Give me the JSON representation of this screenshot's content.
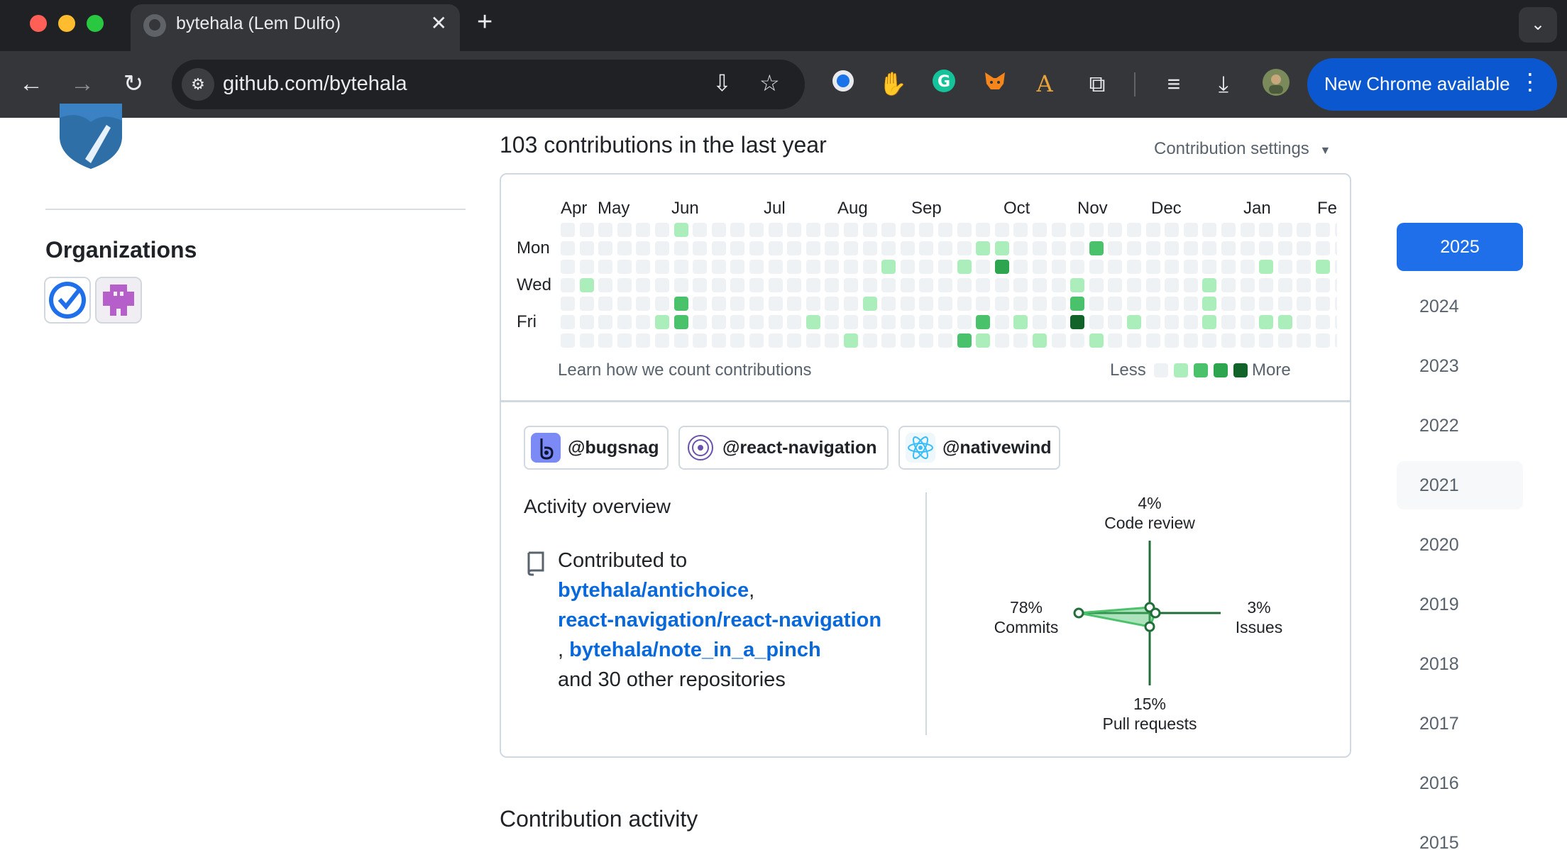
{
  "browser": {
    "tab_title": "bytehala (Lem Dulfo)",
    "tab_close": "✕",
    "new_tab": "+",
    "tab_menu": "⌄",
    "url": "github.com/bytehala",
    "update_label": "New Chrome available",
    "update_menu": "⋮",
    "extensions": [
      "password-manager-icon",
      "extension-icon",
      "grammarly-icon",
      "metamask-icon",
      "font-icon",
      "puzzle-icon"
    ]
  },
  "sidebar": {
    "organizations_heading": "Organizations"
  },
  "contributions": {
    "title": "103 contributions in the last year",
    "settings_label": "Contribution settings",
    "months": [
      "Apr",
      "May",
      "Jun",
      "Jul",
      "Aug",
      "Sep",
      "Oct",
      "Nov",
      "Dec",
      "Jan",
      "Fe"
    ],
    "day_labels": [
      "Mon",
      "Wed",
      "Fri"
    ],
    "learn_link": "Learn how we count contributions",
    "legend_less": "Less",
    "legend_more": "More",
    "colors": {
      "l0": "#eff2f5",
      "l1": "#aceebb",
      "l2": "#4ac26b",
      "l3": "#2da44e",
      "l4": "#116329"
    }
  },
  "orgs_contributed": [
    {
      "label": "@bugsnag"
    },
    {
      "label": "@react-navigation"
    },
    {
      "label": "@nativewind"
    }
  ],
  "activity": {
    "title": "Activity overview",
    "contributed_to": "Contributed to",
    "repo1": "bytehala/antichoice",
    "comma1": ",",
    "repo2": "react-navigation/react-navigation",
    "comma2": ",",
    "repo3": "bytehala/note_in_a_pinch",
    "others": "and 30 other repositories"
  },
  "radar": {
    "code_review_pct": "4%",
    "code_review_label": "Code review",
    "commits_pct": "78%",
    "commits_label": "Commits",
    "issues_pct": "3%",
    "issues_label": "Issues",
    "pr_pct": "15%",
    "pr_label": "Pull requests",
    "values": {
      "code_review": 4,
      "commits": 78,
      "issues": 3,
      "pull_requests": 15
    }
  },
  "contribution_activity_heading": "Contribution activity",
  "years": [
    "2025",
    "2024",
    "2023",
    "2022",
    "2021",
    "2020",
    "2019",
    "2018",
    "2017",
    "2016",
    "2015"
  ],
  "selected_year": "2025"
}
